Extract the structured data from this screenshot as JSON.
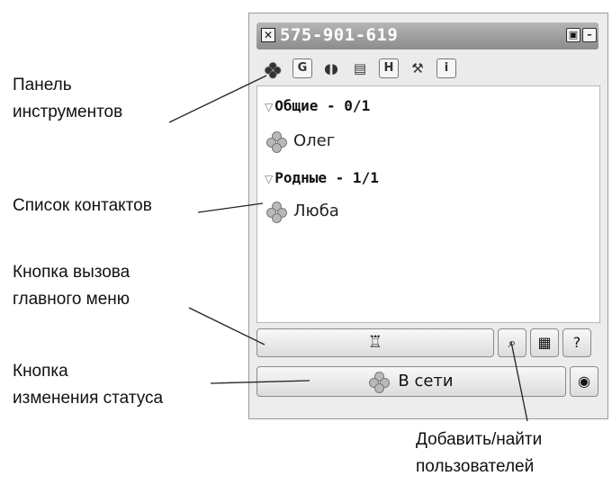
{
  "window": {
    "title": "575-901-619",
    "close_glyph": "✕",
    "restore_glyph": "▣",
    "minimize_glyph": "–"
  },
  "toolbar": {
    "icons": [
      "flower-icon",
      "g-icon",
      "sound-icon",
      "card-icon",
      "h-icon",
      "tools-icon",
      "info-icon"
    ],
    "g_label": "G",
    "h_label": "H",
    "i_label": "i"
  },
  "contacts": {
    "groups": [
      {
        "name": "Общие - 0/1",
        "members": [
          "Олег"
        ]
      },
      {
        "name": "Родные - 1/1",
        "members": [
          "Люба"
        ]
      }
    ]
  },
  "bottom": {
    "status_label": "В сети"
  },
  "callouts": {
    "toolbar_line1": "Панель",
    "toolbar_line2": "инструментов",
    "contacts": "Список контактов",
    "menu_line1": "Кнопка вызова",
    "menu_line2": "главного меню",
    "status_line1": "Кнопка",
    "status_line2": "изменения статуса",
    "find_line1": "Добавить/найти",
    "find_line2": "пользователей"
  }
}
